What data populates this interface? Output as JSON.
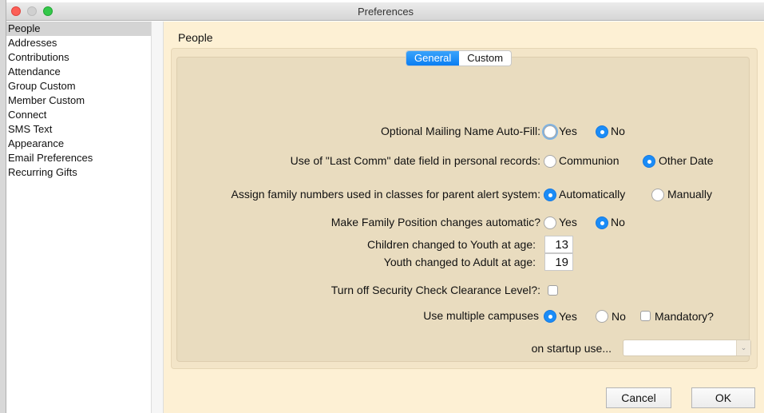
{
  "window": {
    "title": "Preferences"
  },
  "sidebar": {
    "items": [
      {
        "label": "People",
        "selected": true
      },
      {
        "label": "Addresses"
      },
      {
        "label": "Contributions"
      },
      {
        "label": "Attendance"
      },
      {
        "label": "Group Custom"
      },
      {
        "label": "Member Custom"
      },
      {
        "label": "Connect"
      },
      {
        "label": "SMS Text"
      },
      {
        "label": "Appearance"
      },
      {
        "label": "Email Preferences"
      },
      {
        "label": "Recurring Gifts"
      }
    ]
  },
  "main": {
    "heading": "People",
    "tabs": [
      {
        "label": "General",
        "active": true
      },
      {
        "label": "Custom"
      }
    ],
    "mailing": {
      "label": "Optional Mailing Name Auto-Fill:",
      "yes": "Yes",
      "no": "No",
      "selected": "No"
    },
    "lastcomm": {
      "label": "Use of \"Last Comm\" date field in personal records:",
      "opt1": "Communion",
      "opt2": "Other Date",
      "selected": "Other Date"
    },
    "family": {
      "label": "Assign family numbers used in classes for parent alert system:",
      "opt1": "Automatically",
      "opt2": "Manually",
      "selected": "Automatically"
    },
    "position": {
      "label": "Make Family Position changes automatic?",
      "yes": "Yes",
      "no": "No",
      "selected": "No"
    },
    "youth": {
      "label": "Children changed to Youth at age:",
      "value": "13"
    },
    "adult": {
      "label": "Youth changed to Adult at age:",
      "value": "19"
    },
    "security": {
      "label": "Turn off Security Check Clearance Level?:",
      "checked": false
    },
    "campuses": {
      "label": "Use multiple campuses",
      "yes": "Yes",
      "no": "No",
      "selected": "Yes",
      "mandatory": "Mandatory?",
      "mandatory_checked": false
    },
    "startup": {
      "label": "on startup use...",
      "value": ""
    },
    "cancel": "Cancel",
    "ok": "OK"
  }
}
